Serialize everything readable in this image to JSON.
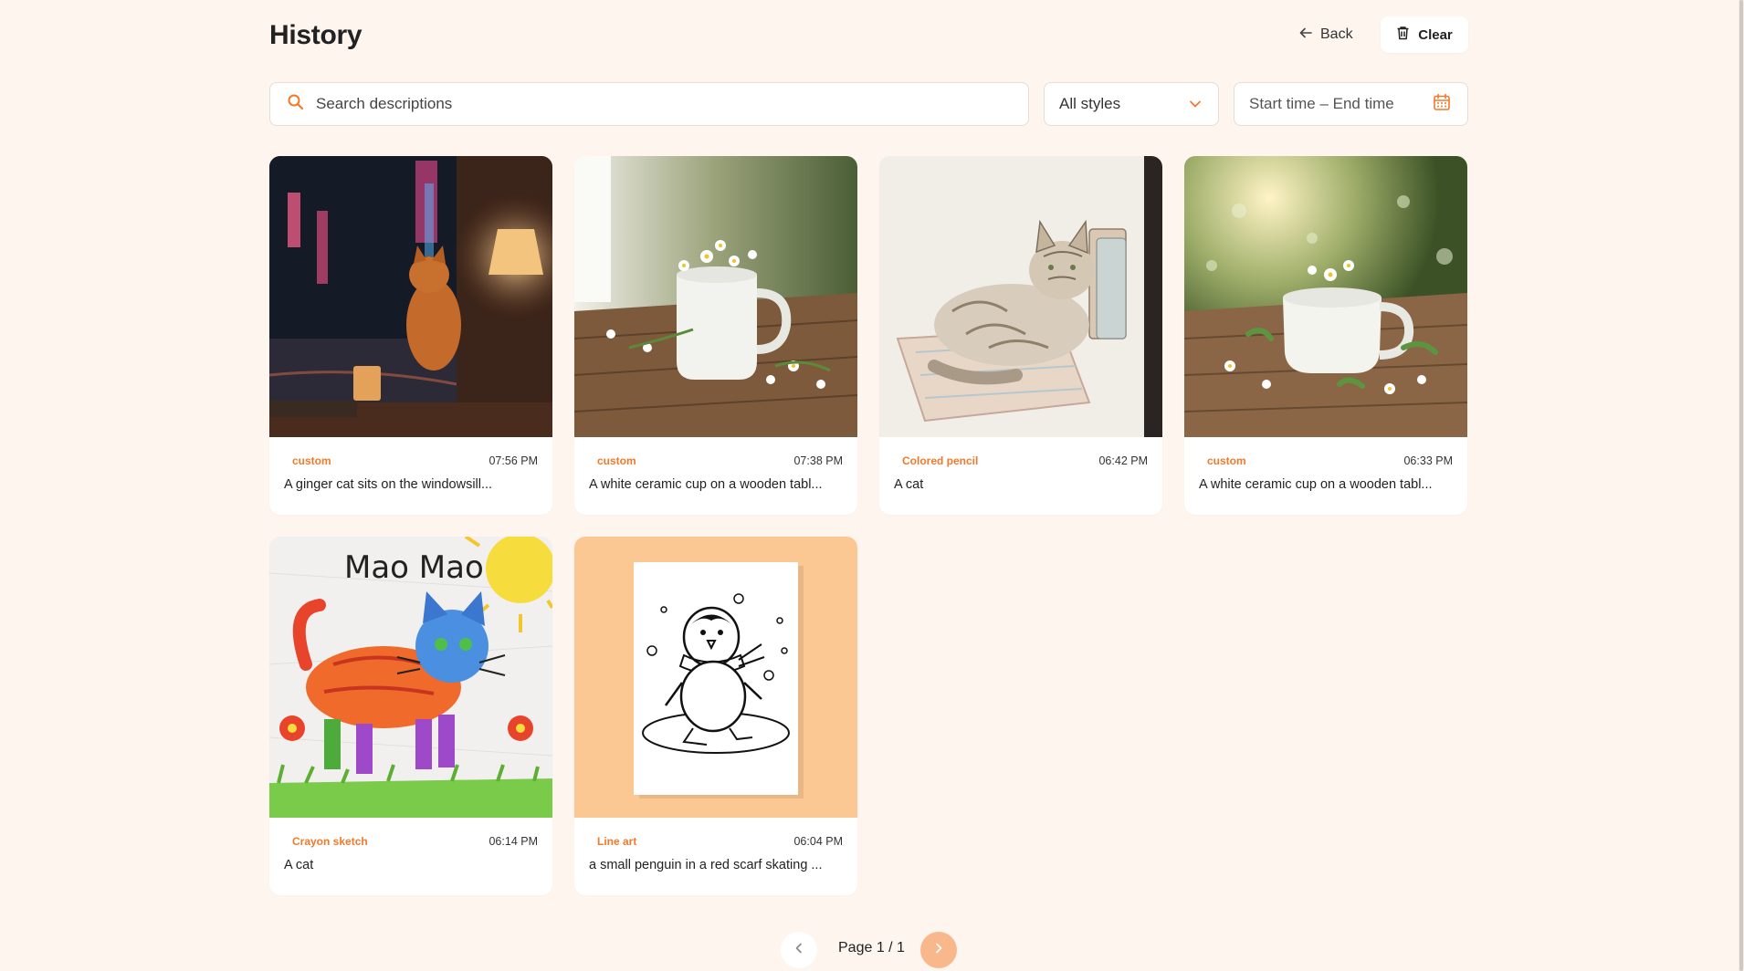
{
  "header": {
    "title": "History",
    "back_label": "Back",
    "clear_label": "Clear"
  },
  "filters": {
    "search_placeholder": "Search descriptions",
    "style_selected": "All styles",
    "date_range_placeholder": "Start time – End time"
  },
  "cards": [
    {
      "style": "custom",
      "time": "07:56 PM",
      "description": "A ginger cat sits on the windowsill..."
    },
    {
      "style": "custom",
      "time": "07:38 PM",
      "description": "A white ceramic cup on a wooden tabl..."
    },
    {
      "style": "Colored pencil",
      "time": "06:42 PM",
      "description": "A cat"
    },
    {
      "style": "custom",
      "time": "06:33 PM",
      "description": "A white ceramic cup on a wooden tabl..."
    },
    {
      "style": "Crayon sketch",
      "time": "06:14 PM",
      "description": "A cat",
      "thumb_text": "Mao Mao"
    },
    {
      "style": "Line art",
      "time": "06:04 PM",
      "description": "a small penguin in a red scarf skating ..."
    }
  ],
  "pagination": {
    "label": "Page 1 / 1"
  },
  "icons": {
    "search": "search-icon",
    "back": "arrow-left-icon",
    "clear": "trash-icon",
    "select": "chevron-down-icon",
    "calendar": "calendar-icon",
    "prev": "chevron-left-icon",
    "next": "chevron-right-icon"
  },
  "colors": {
    "background": "#fdf5ee",
    "accent": "#f07a2c",
    "next_button": "#f9b88c"
  }
}
